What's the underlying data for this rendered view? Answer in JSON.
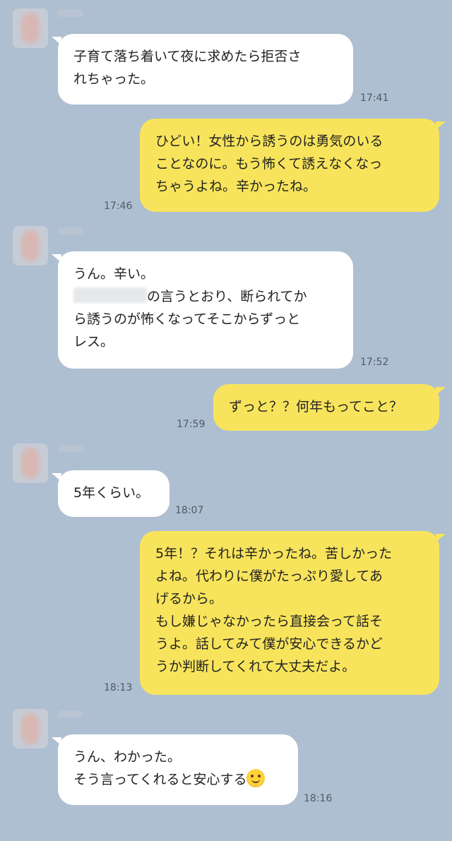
{
  "messages": [
    {
      "lines": [
        "子育て落ち着いて夜に求めたら拒否さ",
        "れちゃった。"
      ],
      "time": "17:41"
    },
    {
      "lines": [
        "ひどい！女性から誘うのは勇気のいる",
        "ことなのに。もう怖くて誘えなくなっ",
        "ちゃうよね。辛かったね。"
      ],
      "time": "17:46"
    },
    {
      "lines": [
        "うん。辛い。",
        "の言うとおり、断られてか",
        "ら誘うのが怖くなってそこからずっと",
        "レス。"
      ],
      "time": "17:52"
    },
    {
      "lines": [
        "ずっと？？何年もってこと？"
      ],
      "time": "17:59"
    },
    {
      "lines": [
        "5年くらい。"
      ],
      "time": "18:07"
    },
    {
      "lines": [
        "5年！？それは辛かったね。苦しかった",
        "よね。代わりに僕がたっぷり愛してあ",
        "げるから。",
        "もし嫌じゃなかったら直接会って話そ",
        "うよ。話してみて僕が安心できるかど",
        "うか判断してくれて大丈夫だよ。"
      ],
      "time": "18:13"
    },
    {
      "lines": [
        "うん、わかった。",
        "そう言ってくれると安心する"
      ],
      "time": "18:16",
      "emoji": "smile-icon"
    }
  ],
  "colors": {
    "background": "#aebfd1",
    "incoming": "#ffffff",
    "outgoing": "#f8e45c"
  }
}
